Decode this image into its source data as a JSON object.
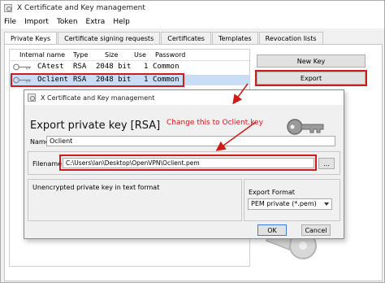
{
  "main_window": {
    "title": "X Certificate and Key management",
    "menus": [
      "File",
      "Import",
      "Token",
      "Extra",
      "Help"
    ],
    "tabs": [
      "Private Keys",
      "Certificate signing requests",
      "Certificates",
      "Templates",
      "Revocation lists"
    ],
    "columns": [
      "Internal name",
      "Type",
      "Size",
      "Use",
      "Password"
    ],
    "keys": [
      {
        "name": "CAtest",
        "type": "RSA",
        "size": "2048 bit",
        "use": "1",
        "password": "Common"
      },
      {
        "name": "Oclient",
        "type": "RSA",
        "size": "2048 bit",
        "use": "1",
        "password": "Common"
      }
    ],
    "buttons": {
      "new_key": "New Key",
      "export": "Export"
    }
  },
  "dialog": {
    "title": "X Certificate and Key management",
    "heading": "Export private key [RSA]",
    "annotation": "Change this to Oclient.key",
    "name_label": "Name",
    "name_value": "Oclient",
    "filename_label": "Filename",
    "filename_value": "C:\\Users\\lan\\Desktop\\OpenVPN\\Oclient.pem",
    "browse_label": "...",
    "description": "Unencrypted private key in text format",
    "format_label": "Export Format",
    "format_value": "PEM private (*.pem)",
    "ok_label": "OK",
    "cancel_label": "Cancel"
  },
  "colors": {
    "highlight": "#d11a1a",
    "selection": "#c9def5"
  },
  "icons": [
    "app-icon",
    "key-icon",
    "key-graphic"
  ]
}
